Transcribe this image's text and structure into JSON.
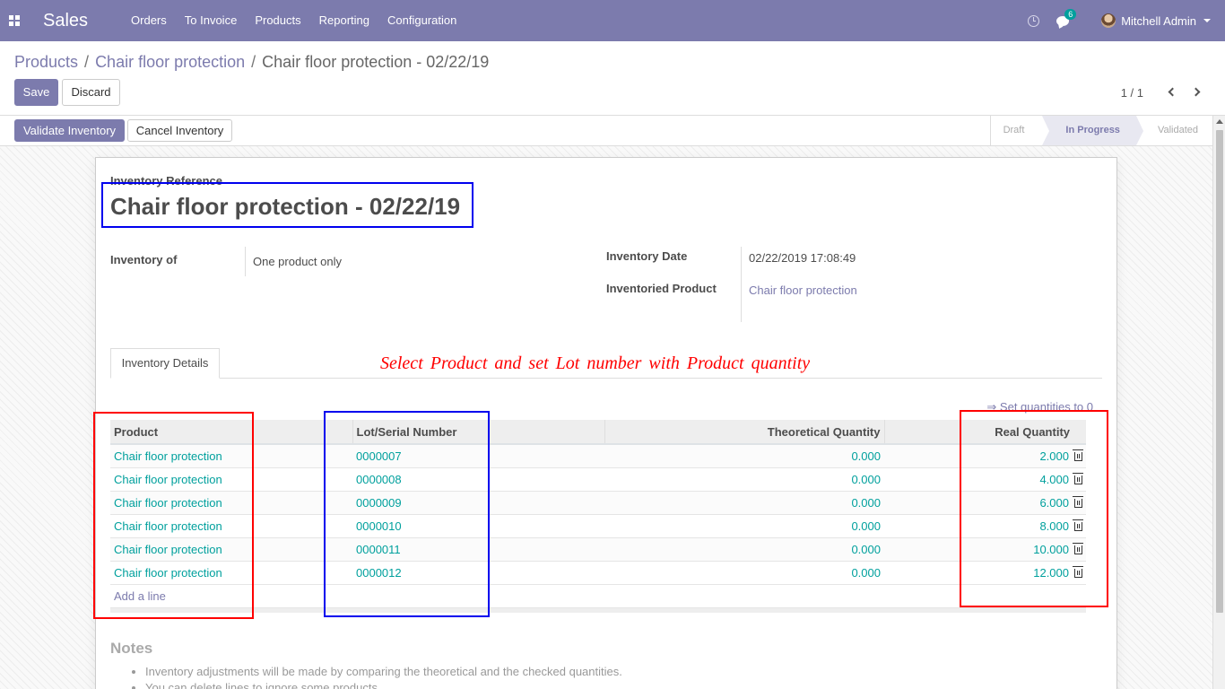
{
  "navbar": {
    "brand": "Sales",
    "menu": [
      "Orders",
      "To Invoice",
      "Products",
      "Reporting",
      "Configuration"
    ],
    "messages_count": "6",
    "user_name": "Mitchell Admin"
  },
  "breadcrumb": {
    "items": [
      "Products",
      "Chair floor protection"
    ],
    "current": "Chair floor protection - 02/22/19"
  },
  "control": {
    "save_label": "Save",
    "discard_label": "Discard",
    "pager": "1 / 1"
  },
  "statusbar": {
    "validate_label": "Validate Inventory",
    "cancel_label": "Cancel Inventory",
    "stages": [
      "Draft",
      "In Progress",
      "Validated"
    ],
    "active_stage": "In Progress"
  },
  "form": {
    "reference_label": "Inventory Reference",
    "reference_value": "Chair floor protection - 02/22/19",
    "inventory_of_label": "Inventory of",
    "inventory_of_value": "One product only",
    "date_label": "Inventory Date",
    "date_value": "02/22/2019 17:08:49",
    "product_label": "Inventoried Product",
    "product_value": "Chair floor protection"
  },
  "tabs": {
    "details_label": "Inventory Details"
  },
  "annotation": "Select Product and set Lot number with Product quantity",
  "table": {
    "set_quantities_label": "⇒ Set quantities to 0",
    "columns": [
      "Product",
      "Lot/Serial Number",
      "Theoretical Quantity",
      "Real Quantity"
    ],
    "rows": [
      {
        "product": "Chair floor protection",
        "lot": "0000007",
        "theoretical": "0.000",
        "real": "2.000"
      },
      {
        "product": "Chair floor protection",
        "lot": "0000008",
        "theoretical": "0.000",
        "real": "4.000"
      },
      {
        "product": "Chair floor protection",
        "lot": "0000009",
        "theoretical": "0.000",
        "real": "6.000"
      },
      {
        "product": "Chair floor protection",
        "lot": "0000010",
        "theoretical": "0.000",
        "real": "8.000"
      },
      {
        "product": "Chair floor protection",
        "lot": "0000011",
        "theoretical": "0.000",
        "real": "10.000"
      },
      {
        "product": "Chair floor protection",
        "lot": "0000012",
        "theoretical": "0.000",
        "real": "12.000"
      }
    ],
    "add_line_label": "Add a line"
  },
  "notes": {
    "title": "Notes",
    "items": [
      "Inventory adjustments will be made by comparing the theoretical and the checked quantities.",
      "You can delete lines to ignore some products."
    ]
  },
  "colors": {
    "brand": "#7c7bad",
    "link_teal": "#00a09d",
    "annotation_red": "#ff0000",
    "annotation_blue": "#0000ee"
  }
}
